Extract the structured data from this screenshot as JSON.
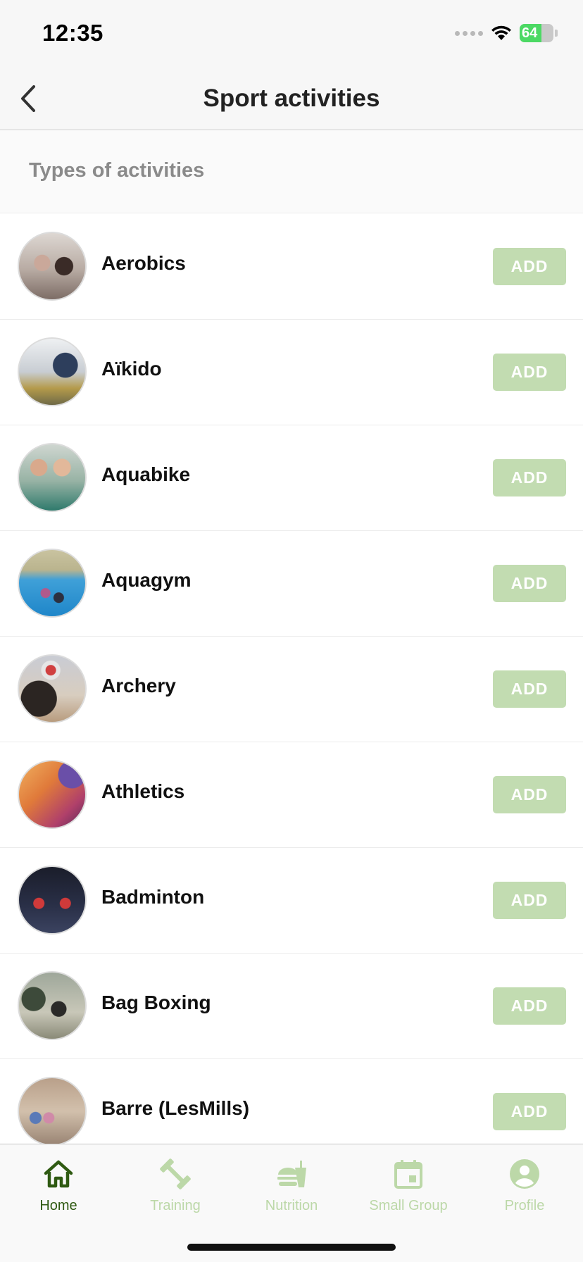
{
  "status_bar": {
    "time": "12:35",
    "battery_level": "64",
    "battery_fraction": 0.64
  },
  "header": {
    "title": "Sport activities"
  },
  "section": {
    "title": "Types of activities"
  },
  "activities": [
    {
      "name": "Aerobics",
      "add_label": "ADD"
    },
    {
      "name": "Aïkido",
      "add_label": "ADD"
    },
    {
      "name": "Aquabike",
      "add_label": "ADD"
    },
    {
      "name": "Aquagym",
      "add_label": "ADD"
    },
    {
      "name": "Archery",
      "add_label": "ADD"
    },
    {
      "name": "Athletics",
      "add_label": "ADD"
    },
    {
      "name": "Badminton",
      "add_label": "ADD"
    },
    {
      "name": "Bag Boxing",
      "add_label": "ADD"
    },
    {
      "name": "Barre (LesMills)",
      "add_label": "ADD"
    }
  ],
  "tabs": [
    {
      "label": "Home",
      "icon": "home-icon",
      "active": true
    },
    {
      "label": "Training",
      "icon": "dumbbell-icon",
      "active": false
    },
    {
      "label": "Nutrition",
      "icon": "nutrition-icon",
      "active": false
    },
    {
      "label": "Small Group",
      "icon": "calendar-icon",
      "active": false
    },
    {
      "label": "Profile",
      "icon": "profile-icon",
      "active": false
    }
  ],
  "colors": {
    "accent_dark": "#2f5a12",
    "accent_light": "#bcd8a8",
    "add_button": "#c2dcb1",
    "battery": "#4cd964"
  }
}
